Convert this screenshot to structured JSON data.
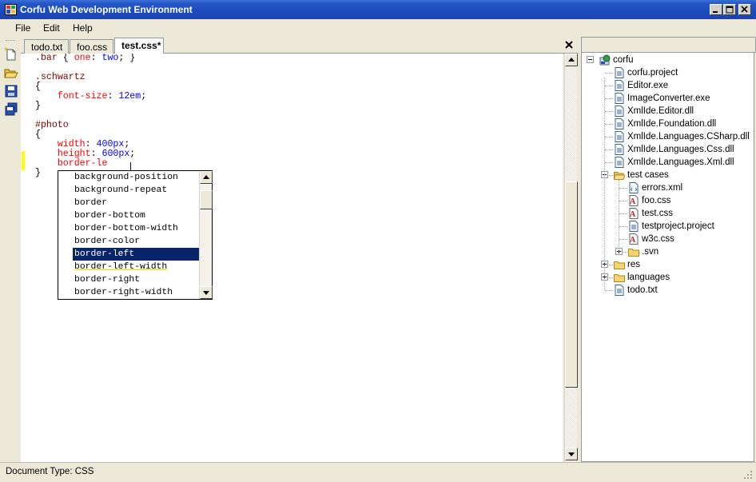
{
  "window": {
    "title": "Corfu Web Development Environment"
  },
  "menu": [
    "File",
    "Edit",
    "Help"
  ],
  "tabs": [
    {
      "label": "todo.txt",
      "active": false
    },
    {
      "label": "foo.css",
      "active": false
    },
    {
      "label": "test.css*",
      "active": true
    }
  ],
  "code_lines": [
    [
      [
        ".bar",
        "sel"
      ],
      [
        " { ",
        "punc"
      ],
      [
        "one",
        "prop"
      ],
      [
        ": ",
        "punc"
      ],
      [
        "two",
        "val"
      ],
      [
        "; }",
        "punc"
      ]
    ],
    [],
    [
      [
        ".schwartz",
        "sel"
      ]
    ],
    [
      [
        "{",
        "punc"
      ]
    ],
    [
      [
        "    font-size",
        "prop"
      ],
      [
        ": ",
        "punc"
      ],
      [
        "12em",
        "val"
      ],
      [
        ";",
        "punc"
      ]
    ],
    [
      [
        "}",
        "punc"
      ]
    ],
    [],
    [
      [
        "#photo",
        "sel"
      ]
    ],
    [
      [
        "{",
        "punc"
      ]
    ],
    [
      [
        "    width",
        "prop"
      ],
      [
        ": ",
        "punc"
      ],
      [
        "400px",
        "val"
      ],
      [
        ";",
        "punc"
      ]
    ],
    [
      [
        "    height",
        "prop"
      ],
      [
        ": ",
        "punc"
      ],
      [
        "600px",
        "val"
      ],
      [
        ";",
        "punc"
      ]
    ],
    [
      [
        "    border-le",
        "prop"
      ]
    ],
    [
      [
        "}",
        "punc"
      ]
    ]
  ],
  "autocomplete": {
    "items": [
      "background-position",
      "background-repeat",
      "border",
      "border-bottom",
      "border-bottom-width",
      "border-color",
      "border-left",
      "border-left-width",
      "border-right",
      "border-right-width"
    ],
    "selected": "border-left",
    "hinted": "border-left-width"
  },
  "tree": [
    {
      "label": "corfu",
      "icon": "project-icon",
      "depth": 0,
      "expander": "minus"
    },
    {
      "label": "corfu.project",
      "icon": "file-icon",
      "depth": 1
    },
    {
      "label": "Editor.exe",
      "icon": "file-icon",
      "depth": 1
    },
    {
      "label": "ImageConverter.exe",
      "icon": "file-icon",
      "depth": 1
    },
    {
      "label": "XmlIde.Editor.dll",
      "icon": "file-icon",
      "depth": 1
    },
    {
      "label": "XmlIde.Foundation.dll",
      "icon": "file-icon",
      "depth": 1
    },
    {
      "label": "XmlIde.Languages.CSharp.dll",
      "icon": "file-icon",
      "depth": 1
    },
    {
      "label": "XmlIde.Languages.Css.dll",
      "icon": "file-icon",
      "depth": 1
    },
    {
      "label": "XmlIde.Languages.Xml.dll",
      "icon": "file-icon",
      "depth": 1
    },
    {
      "label": "test cases",
      "icon": "folder-open-icon",
      "depth": 1,
      "expander": "minus"
    },
    {
      "label": "errors.xml",
      "icon": "xml-file-icon",
      "depth": 2
    },
    {
      "label": "foo.css",
      "icon": "css-file-icon",
      "depth": 2
    },
    {
      "label": "test.css",
      "icon": "css-file-icon",
      "depth": 2
    },
    {
      "label": "testproject.project",
      "icon": "file-icon",
      "depth": 2
    },
    {
      "label": "w3c.css",
      "icon": "css-file-icon",
      "depth": 2
    },
    {
      "label": ".svn",
      "icon": "folder-icon",
      "depth": 2,
      "expander": "plus"
    },
    {
      "label": "res",
      "icon": "folder-icon",
      "depth": 1,
      "expander": "plus"
    },
    {
      "label": "languages",
      "icon": "folder-icon",
      "depth": 1,
      "expander": "plus"
    },
    {
      "label": "todo.txt",
      "icon": "file-icon",
      "depth": 1
    }
  ],
  "status": {
    "text": "Document Type: CSS"
  },
  "colors": {
    "titlebar": "#1c4bbd",
    "selector": "#800000",
    "property": "#ff0000",
    "value": "#0000ff",
    "selection": "#0a246a"
  }
}
